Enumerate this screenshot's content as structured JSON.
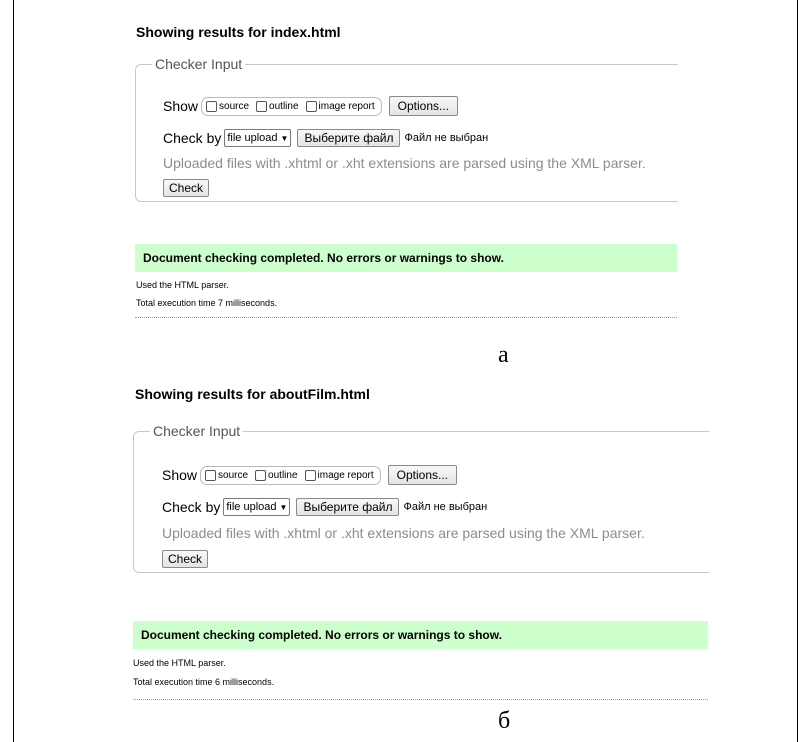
{
  "panel_a": {
    "heading": "Showing results for index.html",
    "legend": "Checker Input",
    "show_label": "Show",
    "opt_source": "source",
    "opt_outline": "outline",
    "opt_image_report": "image report",
    "options_button": "Options...",
    "check_by_label": "Check by",
    "select_value": "file upload",
    "file_button": "Выберите файл",
    "no_file": "Файл не выбран",
    "note": "Uploaded files with .xhtml or .xht extensions are parsed using the XML parser.",
    "check_button": "Check",
    "success": "Document checking completed. No errors or warnings to show.",
    "meta_parser": "Used the HTML parser.",
    "meta_time": "Total execution time 7 milliseconds.",
    "caption": "а"
  },
  "panel_b": {
    "heading": "Showing results for aboutFilm.html",
    "legend": "Checker Input",
    "show_label": "Show",
    "opt_source": "source",
    "opt_outline": "outline",
    "opt_image_report": "image report",
    "options_button": "Options...",
    "check_by_label": "Check by",
    "select_value": "file upload",
    "file_button": "Выберите файл",
    "no_file": "Файл не выбран",
    "note": "Uploaded files with .xhtml or .xht extensions are parsed using the XML parser.",
    "check_button": "Check",
    "success": "Document checking completed. No errors or warnings to show.",
    "meta_parser": "Used the HTML parser.",
    "meta_time": "Total execution time 6 milliseconds.",
    "caption": "б"
  },
  "colors": {
    "success_bg": "#ccffcc",
    "note_text": "#8c8c8c",
    "fieldset_border": "#c8c8c8"
  },
  "icons": {
    "select_chevron": "chevron-down-icon",
    "checkbox": "checkbox-icon"
  }
}
